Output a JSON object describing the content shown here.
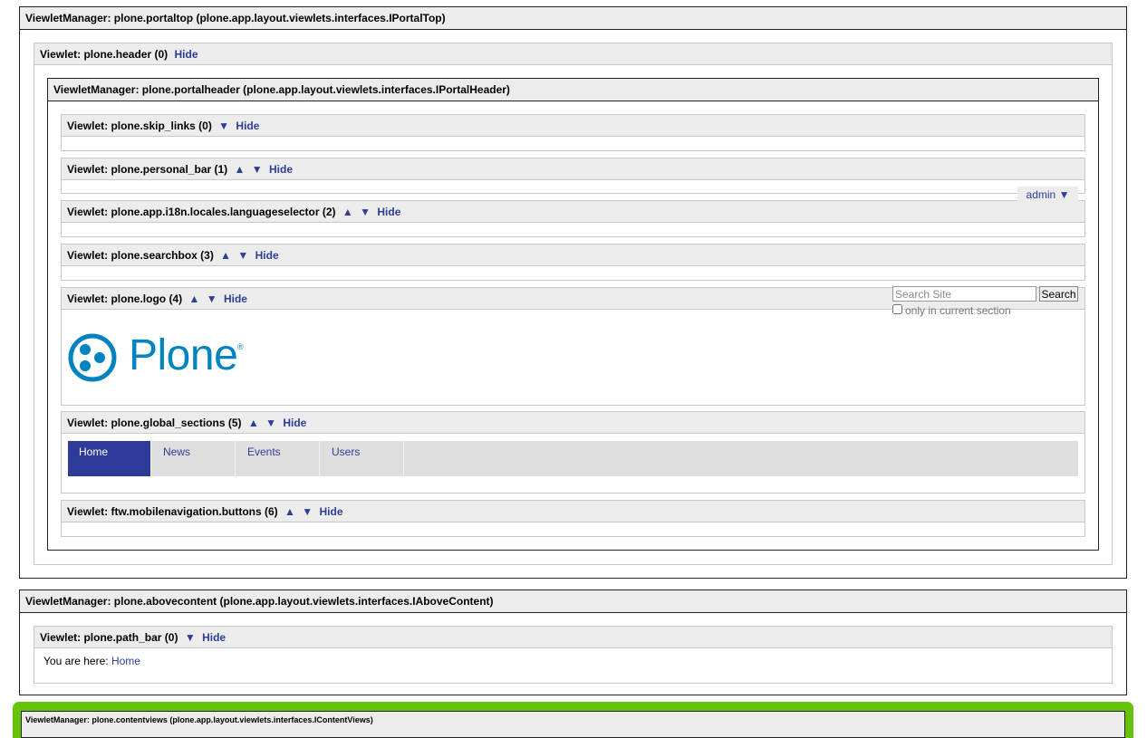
{
  "portaltop": {
    "title": "ViewletManager: plone.portaltop (plone.app.layout.viewlets.interfaces.IPortalTop)",
    "header_viewlet": {
      "title": "Viewlet: plone.header (0)",
      "hide": "Hide"
    },
    "portalheader": {
      "title": "ViewletManager: plone.portalheader (plone.app.layout.viewlets.interfaces.IPortalHeader)",
      "viewlets": {
        "skip_links": {
          "title": "Viewlet: plone.skip_links (0)",
          "down": "▼",
          "hide": "Hide"
        },
        "personal_bar": {
          "title": "Viewlet: plone.personal_bar (1)",
          "up": "▲",
          "down": "▼",
          "hide": "Hide"
        },
        "languageselector": {
          "title": "Viewlet: plone.app.i18n.locales.languageselector (2)",
          "up": "▲",
          "down": "▼",
          "hide": "Hide"
        },
        "searchbox": {
          "title": "Viewlet: plone.searchbox (3)",
          "up": "▲",
          "down": "▼",
          "hide": "Hide"
        },
        "logo": {
          "title": "Viewlet: plone.logo (4)",
          "up": "▲",
          "down": "▼",
          "hide": "Hide"
        },
        "global_sections": {
          "title": "Viewlet: plone.global_sections (5)",
          "up": "▲",
          "down": "▼",
          "hide": "Hide"
        },
        "mobilenavigation": {
          "title": "Viewlet: ftw.mobilenavigation.buttons (6)",
          "up": "▲",
          "down": "▼",
          "hide": "Hide"
        }
      }
    }
  },
  "personal_bar": {
    "user_menu": "admin ▼"
  },
  "search": {
    "placeholder": "Search Site",
    "button": "Search",
    "only_current_section": "only in current section",
    "only_current_section_checked": false
  },
  "logo": {
    "text": "Plone",
    "registered_mark": "®",
    "brand_color": "#0083be"
  },
  "global_nav": {
    "items": [
      "Home",
      "News",
      "Events",
      "Users"
    ],
    "active": "Home",
    "active_color": "#2d3a97"
  },
  "abovecontent": {
    "title": "ViewletManager: plone.abovecontent (plone.app.layout.viewlets.interfaces.IAboveContent)",
    "path_bar": {
      "title": "Viewlet: plone.path_bar (0)",
      "down": "▼",
      "hide": "Hide"
    },
    "you_are_here": "You are here:",
    "crumb": "Home"
  },
  "contentviews": {
    "title": "ViewletManager: plone.contentviews (plone.app.layout.viewlets.interfaces.IContentViews)",
    "band_color": "#67c20a"
  },
  "link_color": "#2e3d96"
}
